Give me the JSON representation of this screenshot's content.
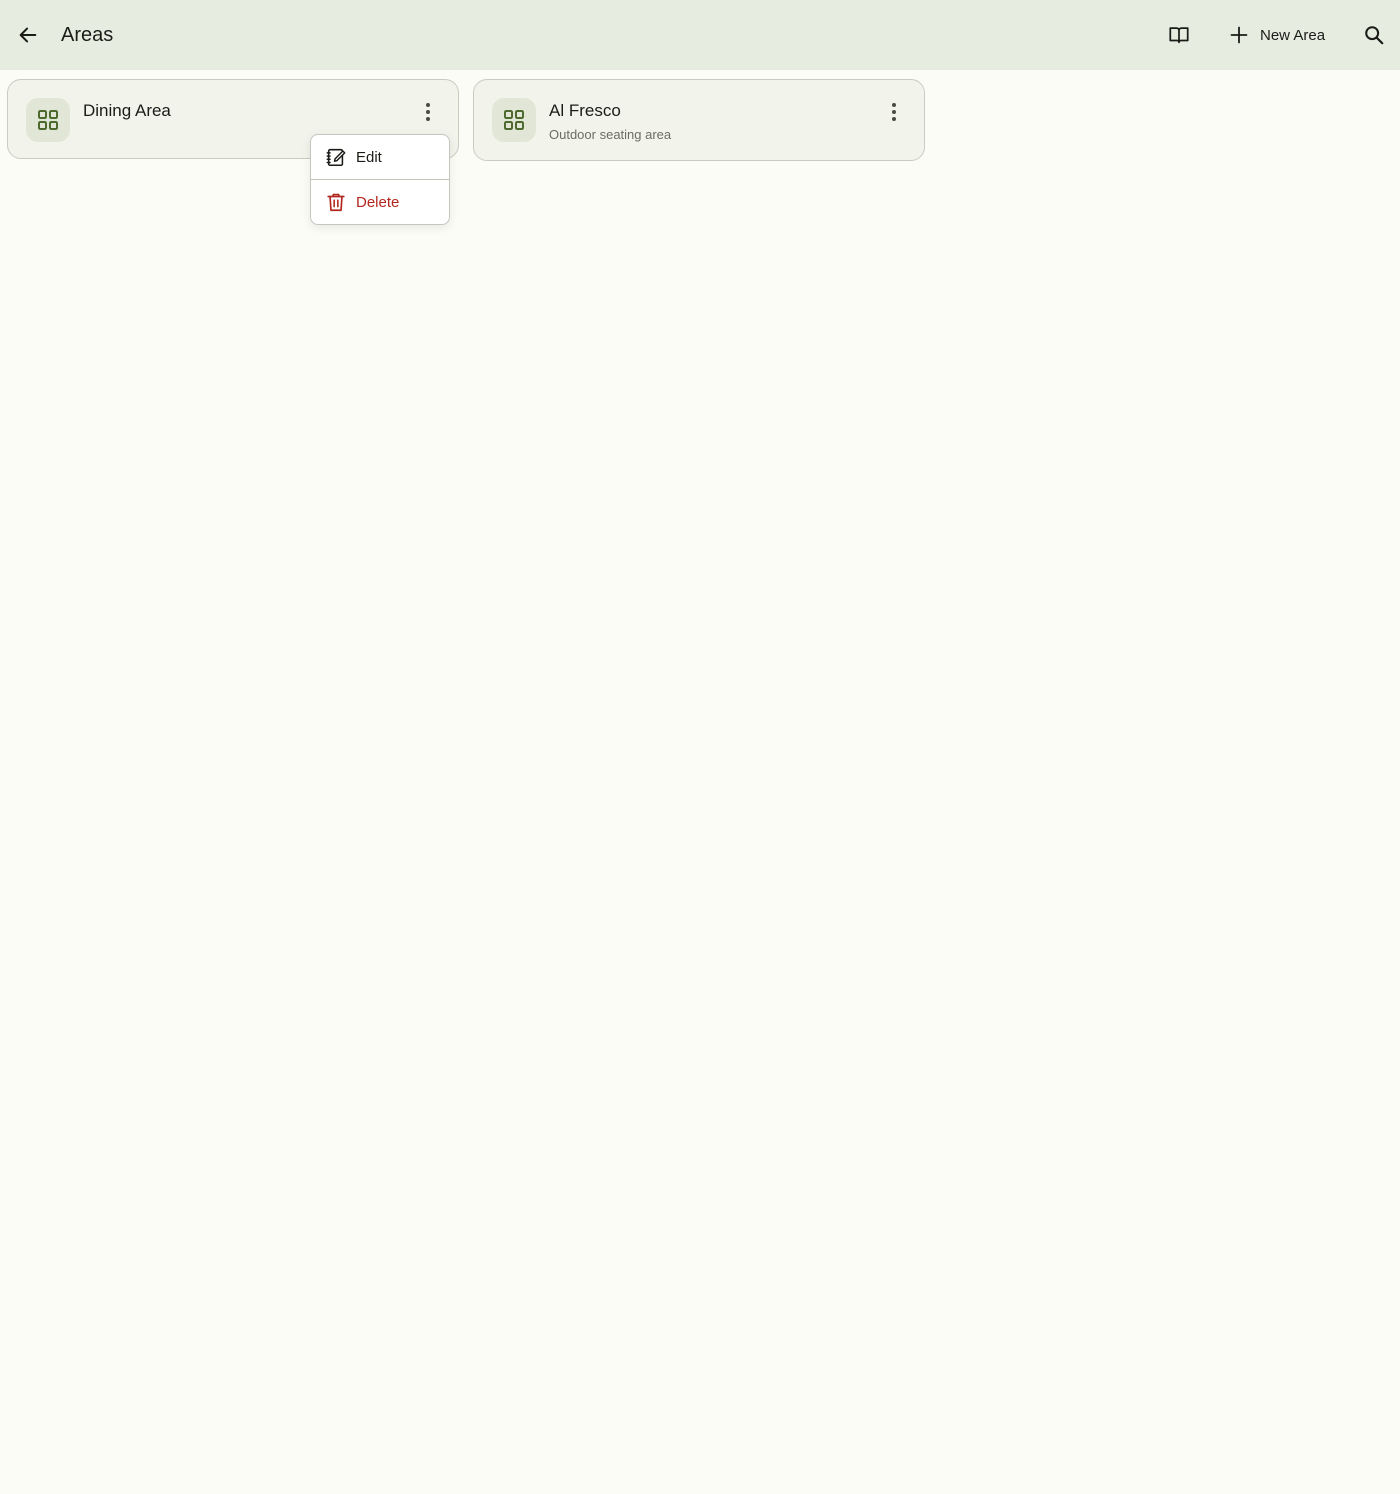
{
  "appbar": {
    "back_icon": "arrow-left-icon",
    "title": "Areas",
    "book_icon": "book-open-icon",
    "new_area_label": "New Area",
    "plus_icon": "plus-icon",
    "search_icon": "search-icon"
  },
  "areas": [
    {
      "name": "Dining Area",
      "description": "",
      "icon": "grid-icon",
      "menu_icon": "more-vertical-icon"
    },
    {
      "name": "Al Fresco",
      "description": "Outdoor seating area",
      "icon": "grid-icon",
      "menu_icon": "more-vertical-icon"
    }
  ],
  "context_menu": {
    "items": [
      {
        "label": "Edit",
        "icon": "edit-note-icon"
      },
      {
        "label": "Delete",
        "icon": "trash-icon"
      }
    ]
  },
  "colors": {
    "page_background": "#fcfcf7",
    "appbar_background": "#e7ece0",
    "card_background": "#f2f4ec",
    "icon_tile_background": "#e1e6d7",
    "icon_accent": "#4e6a2e",
    "delete_red": "#b3261e"
  }
}
